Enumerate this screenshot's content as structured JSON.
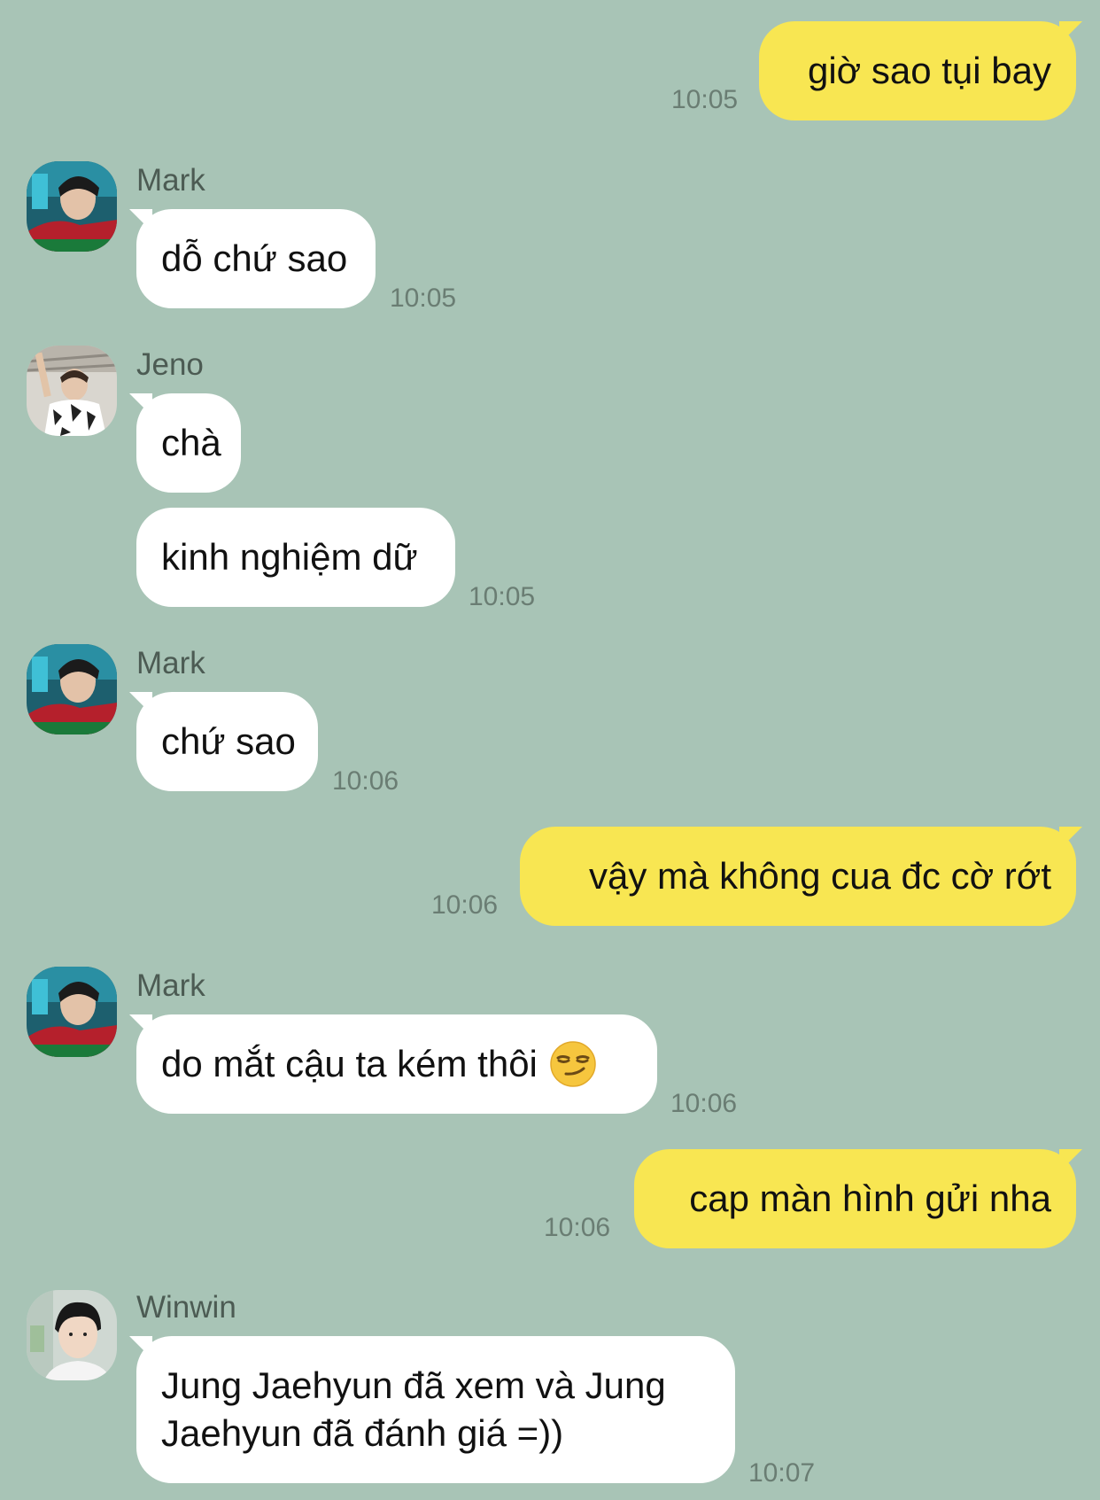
{
  "colors": {
    "background": "#a8c4b6",
    "outgoing_bubble": "#f8e652",
    "incoming_bubble": "#ffffff",
    "timestamp": "#6a7d73"
  },
  "messages": [
    {
      "direction": "out",
      "text": "giờ sao tụi bay",
      "time": "10:05"
    },
    {
      "direction": "in",
      "sender": "Mark",
      "avatar": "mark-avatar",
      "text": "dỗ chứ sao",
      "time": "10:05"
    },
    {
      "direction": "in",
      "sender": "Jeno",
      "avatar": "jeno-avatar",
      "text": "chà"
    },
    {
      "direction": "in",
      "text": "kinh nghiệm dữ",
      "time": "10:05"
    },
    {
      "direction": "in",
      "sender": "Mark",
      "avatar": "mark-avatar",
      "text": "chứ sao",
      "time": "10:06"
    },
    {
      "direction": "out",
      "text": "vậy mà không cua đc cờ rớt",
      "time": "10:06"
    },
    {
      "direction": "in",
      "sender": "Mark",
      "avatar": "mark-avatar",
      "text": "do mắt cậu ta kém thôi",
      "emoji": "smirking-face-emoji",
      "time": "10:06"
    },
    {
      "direction": "out",
      "text": "cap màn hình gửi nha",
      "time": "10:06"
    },
    {
      "direction": "in",
      "sender": "Winwin",
      "avatar": "winwin-avatar",
      "text": "Jung Jaehyun đã xem và Jung Jaehyun đã đánh giá =))",
      "time": "10:07"
    }
  ]
}
